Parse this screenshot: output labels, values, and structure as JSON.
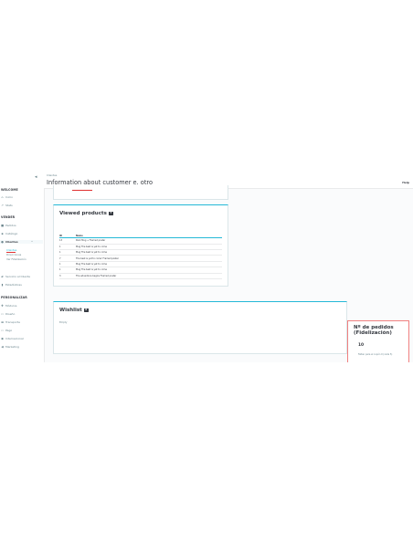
{
  "sidebar": {
    "collapse": "◂",
    "sections": {
      "welcome": "WELCOME",
      "vender": "VENDER",
      "personalizar": "PERSONALIZAR"
    },
    "items": {
      "inicio": "Inicio",
      "stats": "Stats",
      "pedidos": "Pedidos",
      "catalogo": "Catálogo",
      "clientes": "Clientes",
      "servicio": "Servicio al Cliente",
      "estadisticas": "Estadísticas",
      "modulos": "Módulos",
      "diseno": "Diseño",
      "transporte": "Transporte",
      "pago": "Pago",
      "internacional": "Internacional",
      "marketing": "Marketing"
    },
    "subitems": {
      "clientes": "Clientes",
      "direcciones": "Direcciones",
      "fidelizacion": "Ver Fidelización"
    }
  },
  "header": {
    "breadcrumb": "Clientes",
    "title": "Information about customer e. otro",
    "help": "Help"
  },
  "viewed": {
    "title": "Viewed products",
    "count": "7",
    "columns": [
      "ID",
      "Name"
    ],
    "rows": [
      [
        "13",
        "Pack Mug + Framed poster"
      ],
      [
        "1",
        "Mug The best is yet to come"
      ],
      [
        "1",
        "Mug The best is yet to come"
      ],
      [
        "7",
        "The best is yet to come' Framed poster"
      ],
      [
        "1",
        "Mug The best is yet to come"
      ],
      [
        "1",
        "Mug The best is yet to come"
      ],
      [
        "3",
        "The adventure begins Framed poster"
      ]
    ]
  },
  "wishlist": {
    "title": "Wishlist",
    "count": "0",
    "empty": "Empty"
  },
  "fidelity": {
    "title": "Nº de pedidos (Fidelización)",
    "count": "10",
    "note": "Faltan para el cupón 0 (cada 5)"
  },
  "colors": {
    "accent": "#25b9d7",
    "highlight": "#f08080",
    "text": "#363a41"
  },
  "icons": {
    "inicio": "home-icon",
    "stats": "trending-up-icon",
    "pedidos": "cart-icon",
    "catalogo": "store-icon",
    "clientes": "person-icon",
    "servicio": "chat-icon",
    "estadisticas": "bar-chart-icon",
    "modulos": "puzzle-icon",
    "diseno": "desktop-icon",
    "transporte": "truck-icon",
    "pago": "card-icon",
    "internacional": "globe-icon",
    "marketing": "megaphone-icon"
  }
}
